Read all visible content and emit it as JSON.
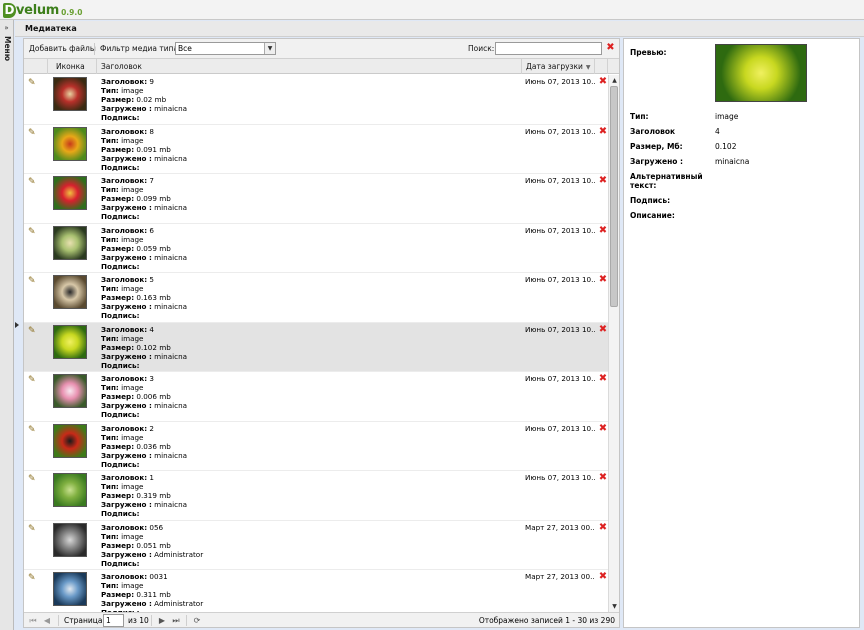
{
  "app": {
    "logo_letter": "D",
    "logo_name": "velum",
    "version": "0.9.0"
  },
  "menu": {
    "label": "Меню",
    "expand_icon": "double-chevron-right-icon"
  },
  "panel": {
    "title": "Медиатека"
  },
  "toolbar": {
    "add_files": "Добавить файлы",
    "filter_label": "Фильтр медиа типа:",
    "filter_value": "Все",
    "search_label": "Поиск:",
    "search_value": ""
  },
  "columns": {
    "icon": "Иконка",
    "title": "Заголовок",
    "date": "Дата загрузки"
  },
  "field_labels": {
    "title": "Заголовок:",
    "type": "Тип:",
    "size": "Размер:",
    "uploaded": "Загружено :",
    "caption": "Подпись:"
  },
  "rows": [
    {
      "title": "9",
      "type": "image",
      "size": "0.02 mb",
      "uploaded": "minaicna",
      "date": "Июнь 07, 2013 10...",
      "thumb": [
        "#3a2a12",
        "#b8302a",
        "#e8d2a0"
      ]
    },
    {
      "title": "8",
      "type": "image",
      "size": "0.091 mb",
      "uploaded": "minaicna",
      "date": "Июнь 07, 2013 10...",
      "thumb": [
        "#4e8a1c",
        "#e8a818",
        "#c83a1a"
      ]
    },
    {
      "title": "7",
      "type": "image",
      "size": "0.099 mb",
      "uploaded": "minaicna",
      "date": "Июнь 07, 2013 10...",
      "thumb": [
        "#2f6e1c",
        "#d8202e",
        "#f0c040"
      ]
    },
    {
      "title": "6",
      "type": "image",
      "size": "0.059 mb",
      "uploaded": "minaicna",
      "date": "Июнь 07, 2013 10...",
      "thumb": [
        "#2b3a20",
        "#a8c070",
        "#e8e0b0"
      ]
    },
    {
      "title": "5",
      "type": "image",
      "size": "0.163 mb",
      "uploaded": "minaicna",
      "date": "Июнь 07, 2013 10...",
      "thumb": [
        "#5a4a30",
        "#d8c8a8",
        "#2a2a2a"
      ]
    },
    {
      "title": "4",
      "type": "image",
      "size": "0.102 mb",
      "uploaded": "minaicna",
      "date": "Июнь 07, 2013 10...",
      "thumb": [
        "#2e6a10",
        "#c8d820",
        "#f0f060"
      ],
      "selected": true
    },
    {
      "title": "3",
      "type": "image",
      "size": "0.006 mb",
      "uploaded": "minaicna",
      "date": "Июнь 07, 2013 10...",
      "thumb": [
        "#3a5a2a",
        "#e890b0",
        "#f8e8f0"
      ]
    },
    {
      "title": "2",
      "type": "image",
      "size": "0.036 mb",
      "uploaded": "minaicna",
      "date": "Июнь 07, 2013 10...",
      "thumb": [
        "#3e7a18",
        "#c82a18",
        "#1a1a1a"
      ]
    },
    {
      "title": "1",
      "type": "image",
      "size": "0.319 mb",
      "uploaded": "minaicna",
      "date": "Июнь 07, 2013 10...",
      "thumb": [
        "#3a7a20",
        "#80b040",
        "#c8e090"
      ]
    },
    {
      "title": "056",
      "type": "image",
      "size": "0.051 mb",
      "uploaded": "Administrator",
      "date": "Март 27, 2013 00...",
      "thumb": [
        "#2a2a2a",
        "#8a8a8a",
        "#d8d8d8"
      ]
    },
    {
      "title": "0031",
      "type": "image",
      "size": "0.311 mb",
      "uploaded": "Administrator",
      "date": "Март 27, 2013 00...",
      "thumb": [
        "#1a3a5a",
        "#6a9ac8",
        "#e0e8f0"
      ]
    }
  ],
  "pager": {
    "page_label": "Страница",
    "page_value": "1",
    "of_label": "из 10",
    "status": "Отображено записей 1 - 30 из 290"
  },
  "preview": {
    "preview_label": "Превью:",
    "type_label": "Тип:",
    "type_value": "image",
    "title_label": "Заголовок",
    "title_value": "4",
    "size_label": "Размер, Мб:",
    "size_value": "0.102",
    "uploaded_label": "Загружено :",
    "uploaded_value": "minaicna",
    "alt_label_1": "Альтернативный",
    "alt_label_2": "текст:",
    "caption_label": "Подпись:",
    "description_label": "Описание:",
    "image_colors": [
      "#2e6a10",
      "#c8d820",
      "#f0f060"
    ]
  }
}
